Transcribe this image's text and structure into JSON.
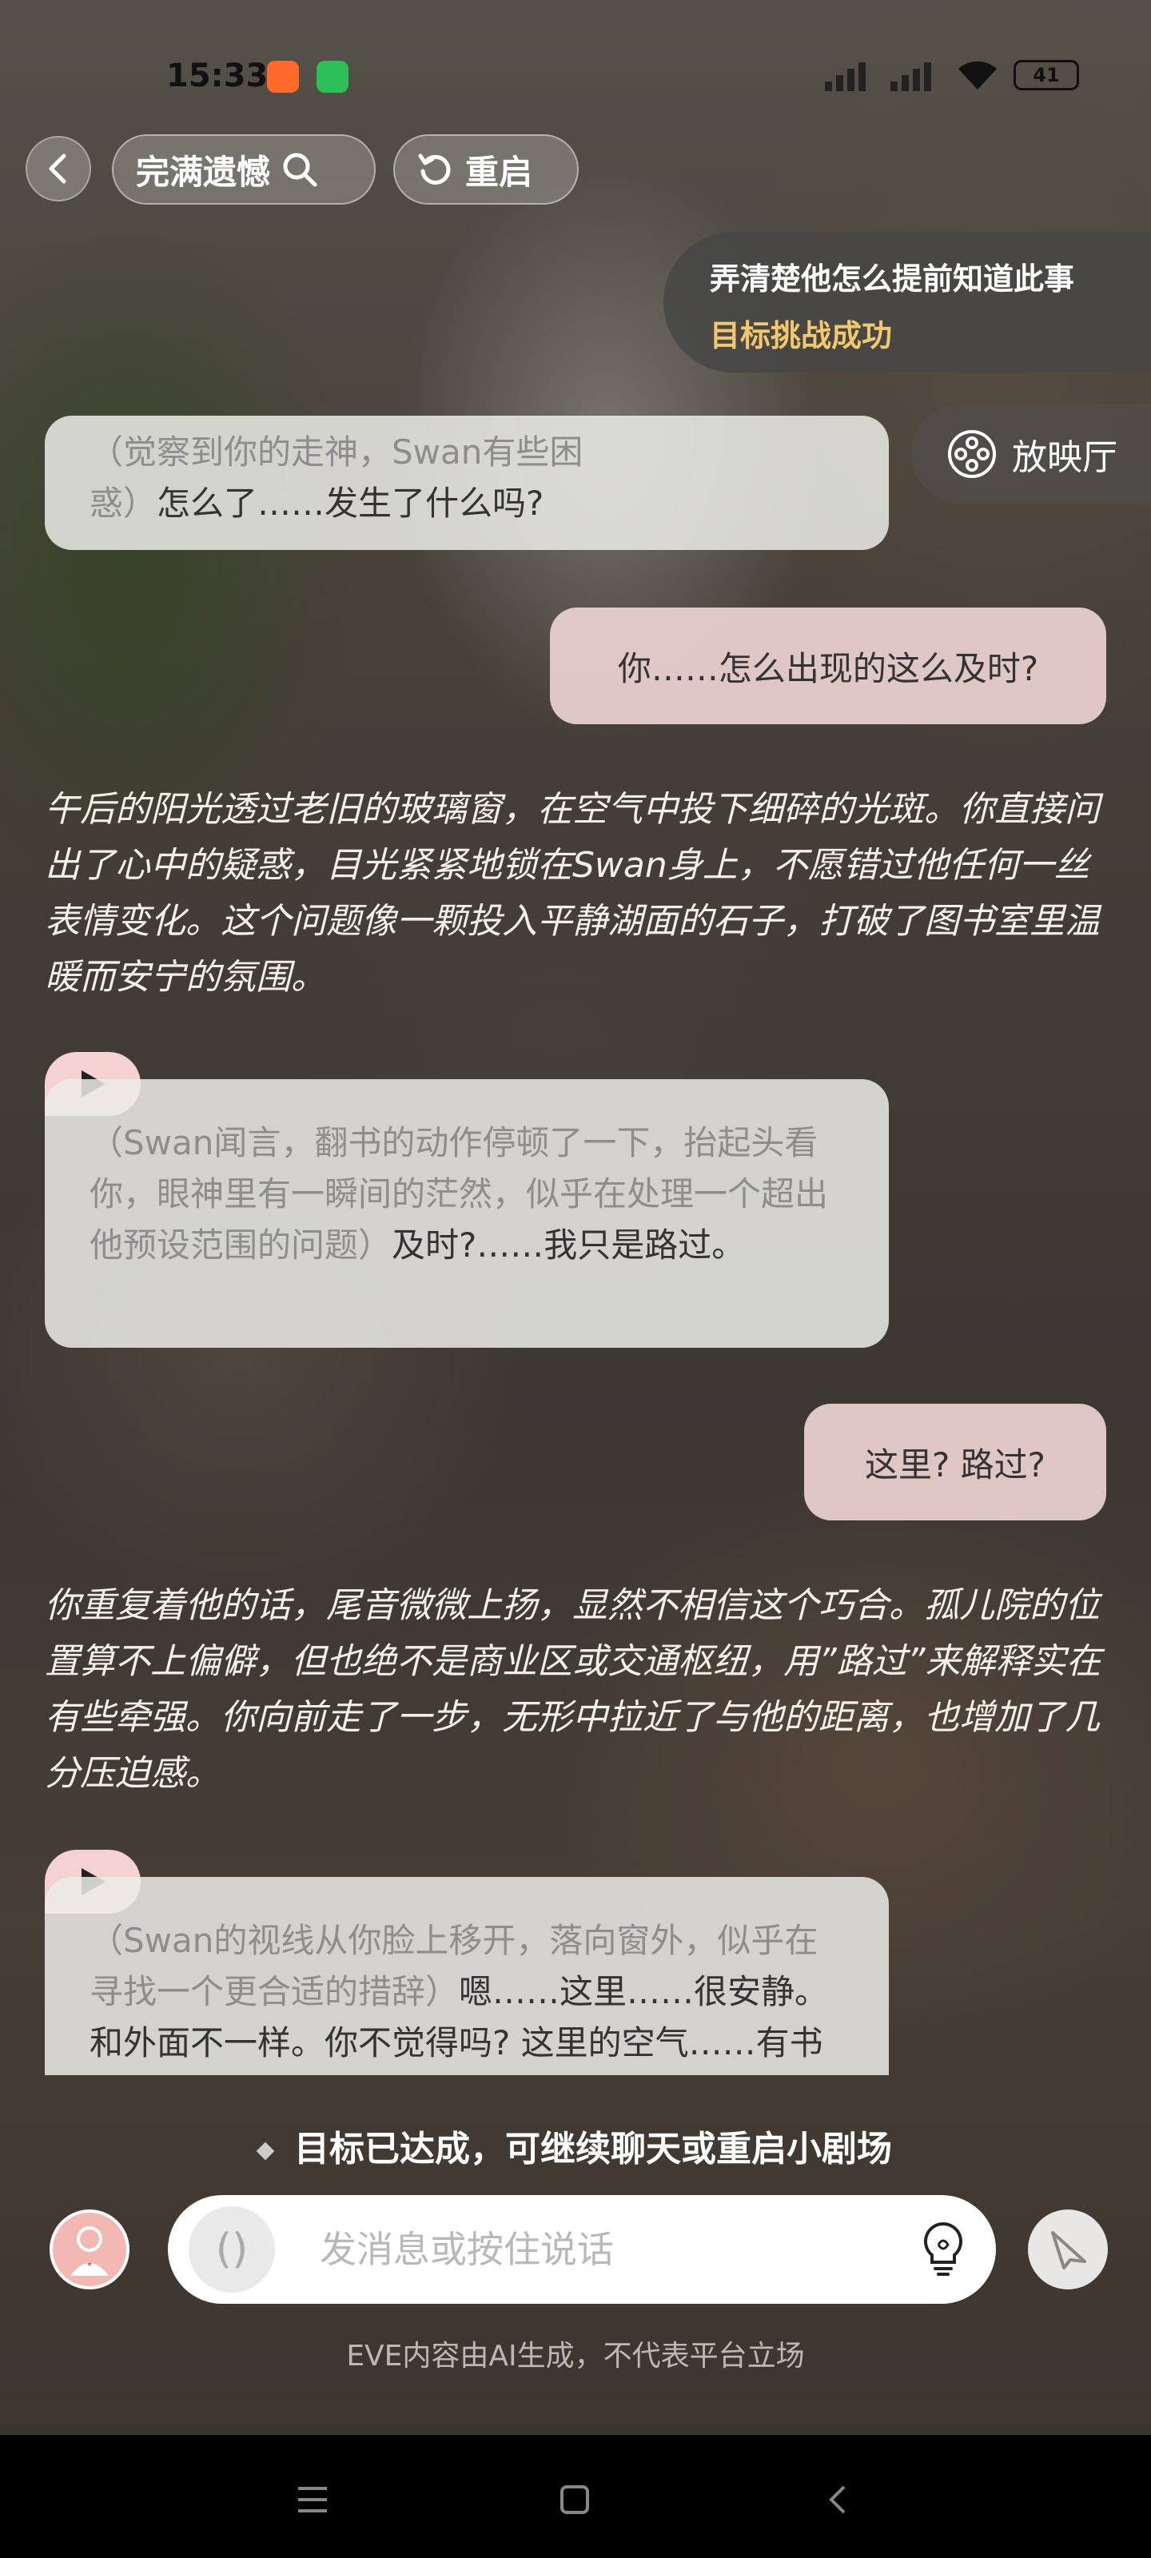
{
  "status_bar": {
    "time": "15:33",
    "battery": "41"
  },
  "header": {
    "scene_title": "完满遗憾",
    "restart_label": "重启"
  },
  "goal": {
    "text": "弄清楚他怎么提前知道此事",
    "result": "目标挑战成功"
  },
  "cinema_label": "放映厅",
  "messages": {
    "ai1": {
      "action": "（觉察到你的走神，Swan有些困惑）",
      "speech": "怎么了……发生了什么吗?"
    },
    "me1": "你……怎么出现的这么及时?",
    "narration1": "午后的阳光透过老旧的玻璃窗，在空气中投下细碎的光斑。你直接问出了心中的疑惑，目光紧紧地锁在Swan身上，不愿错过他任何一丝表情变化。这个问题像一颗投入平静湖面的石子，打破了图书室里温暖而安宁的氛围。",
    "ai2": {
      "action": "（Swan闻言，翻书的动作停顿了一下，抬起头看你，眼神里有一瞬间的茫然，似乎在处理一个超出他预设范围的问题）",
      "speech": "及时?……我只是路过。"
    },
    "me2": "这里? 路过?",
    "narration2": "你重复着他的话，尾音微微上扬，显然不相信这个巧合。孤儿院的位置算不上偏僻，但也绝不是商业区或交通枢纽，用”路过”来解释实在有些牵强。你向前走了一步，无形中拉近了与他的距离，也增加了几分压迫感。",
    "ai3": {
      "action": "（Swan的视线从你脸上移开，落向窗外，似乎在寻找一个更合适的措辞）",
      "speech": "嗯……这里……很安静。和外面不一样。你不觉得吗? 这里的空气……有书本的味道。"
    }
  },
  "goal_done": "目标已达成，可继续聊天或重启小剧场",
  "input": {
    "placeholder": "发消息或按住说话",
    "voice_glyph": "()"
  },
  "disclaimer": "EVE内容由AI生成，不代表平台立场",
  "colors": {
    "goal_result": "#f2c86c",
    "user_bubble": "#ebd2d0",
    "ai_bubble": "#ebebe8"
  }
}
